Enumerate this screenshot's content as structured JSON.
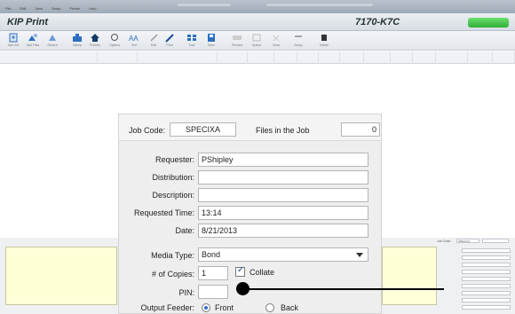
{
  "app": {
    "title": "KIP Print",
    "model": "7170-K7C"
  },
  "menubar": {
    "items": [
      "File",
      "Edit",
      "View",
      "Setup",
      "Printer",
      "Help"
    ]
  },
  "toolbar": {
    "items": [
      {
        "label": "Add Job",
        "icon": "add-file-icon"
      },
      {
        "label": "Add Files",
        "icon": "add-files-icon"
      },
      {
        "label": "Recent",
        "icon": "recent-icon"
      },
      {
        "label": "Stamp",
        "icon": "stamp-icon"
      },
      {
        "label": "Presets",
        "icon": "presets-icon"
      },
      {
        "label": "Options",
        "icon": "options-icon"
      },
      {
        "label": "Text",
        "icon": "text-icon"
      },
      {
        "label": "Edit",
        "icon": "edit-icon"
      },
      {
        "label": "Print",
        "icon": "pen-icon"
      },
      {
        "label": "Fold",
        "icon": "fold-icon"
      },
      {
        "label": "Save",
        "icon": "save-icon"
      },
      {
        "label": "Preview",
        "icon": "preview-icon"
      },
      {
        "label": "Queue",
        "icon": "queue-icon"
      },
      {
        "label": "Clear",
        "icon": "clear-icon"
      },
      {
        "label": "Setup",
        "icon": "setup-icon"
      },
      {
        "label": "Delete",
        "icon": "delete-icon"
      }
    ],
    "accent": "#2d6fc0"
  },
  "dialog": {
    "job_code_label": "Job Code:",
    "job_code_value": "SPECIXA",
    "files_label": "Files in the Job",
    "files_value": "0",
    "requester_label": "Requester:",
    "requester_value": "PShipley",
    "distribution_label": "Distribution:",
    "distribution_value": "",
    "description_label": "Description:",
    "description_value": "",
    "requested_time_label": "Requested Time:",
    "requested_time_value": "13:14",
    "date_label": "Date:",
    "date_value": "8/21/2013",
    "media_type_label": "Media Type:",
    "media_type_value": "Bond",
    "copies_label": "# of Copies:",
    "copies_value": "1",
    "collate_label": "Collate",
    "collate_checked": true,
    "pin_label": "PIN:",
    "pin_value": "",
    "output_feeder_label": "Output Feeder:",
    "front_label": "Front",
    "back_label": "Back",
    "output_selected": "Front"
  },
  "right_panel": {
    "job_code_label": "Job Code:",
    "job_code_value": "SPECIXA"
  }
}
